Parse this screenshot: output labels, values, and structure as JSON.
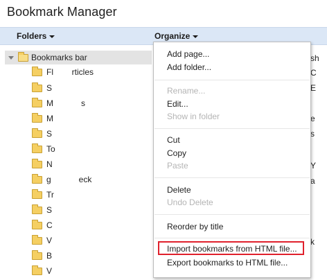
{
  "app": {
    "title": "Bookmark Manager"
  },
  "header": {
    "folders_label": "Folders",
    "organize_label": "Organize"
  },
  "tree": {
    "root_label": "Bookmarks bar",
    "items": [
      {
        "label": "Fl        rticles"
      },
      {
        "label": "S"
      },
      {
        "label": "M            s"
      },
      {
        "label": "M"
      },
      {
        "label": "S"
      },
      {
        "label": "To"
      },
      {
        "label": "N"
      },
      {
        "label": "g            eck"
      },
      {
        "label": "Tr"
      },
      {
        "label": "S"
      },
      {
        "label": "C"
      },
      {
        "label": "V"
      },
      {
        "label": "B"
      },
      {
        "label": "V"
      }
    ]
  },
  "peek": [
    "sh",
    "C",
    "E",
    "",
    "e",
    "s",
    "",
    "",
    "Y",
    "a",
    "",
    "",
    "k",
    ""
  ],
  "organize_menu": {
    "add_page": "Add page...",
    "add_folder": "Add folder...",
    "rename": "Rename...",
    "edit": "Edit...",
    "show_in_folder": "Show in folder",
    "cut": "Cut",
    "copy": "Copy",
    "paste": "Paste",
    "delete": "Delete",
    "undo_delete": "Undo Delete",
    "reorder_by_title": "Reorder by title",
    "import_html": "Import bookmarks from HTML file...",
    "export_html": "Export bookmarks to HTML file..."
  },
  "colors": {
    "header_bg": "#dbe7f6",
    "highlight_border": "#e0202c",
    "disabled_text": "#b4b4b4",
    "folder_fill": "#f5cf62"
  }
}
